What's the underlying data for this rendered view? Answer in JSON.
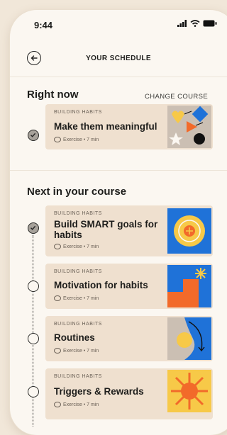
{
  "status_bar": {
    "time": "9:44"
  },
  "header": {
    "title": "YOUR SCHEDULE"
  },
  "right_now": {
    "heading": "Right now",
    "change_label": "CHANGE COURSE",
    "item": {
      "category": "BUILDING HABITS",
      "title": "Make them meaningful",
      "meta": "Exercise • 7 min",
      "done": true
    }
  },
  "next": {
    "heading": "Next in your course",
    "items": [
      {
        "category": "BUILDING HABITS",
        "title": "Build SMART goals for habits",
        "meta": "Exercise • 7 min",
        "done": true
      },
      {
        "category": "BUILDING HABITS",
        "title": "Motivation for habits",
        "meta": "Exercise • 7 min",
        "done": false
      },
      {
        "category": "BUILDING HABITS",
        "title": "Routines",
        "meta": "Exercise • 7 min",
        "done": false
      },
      {
        "category": "BUILDING HABITS",
        "title": "Triggers & Rewards",
        "meta": "Exercise • 7 min",
        "done": false
      }
    ]
  },
  "colors": {
    "background": "#f1e7d9",
    "card": "#efe0cf",
    "blue": "#1f72d8",
    "orange": "#f26a2a",
    "yellow": "#f7c948"
  }
}
